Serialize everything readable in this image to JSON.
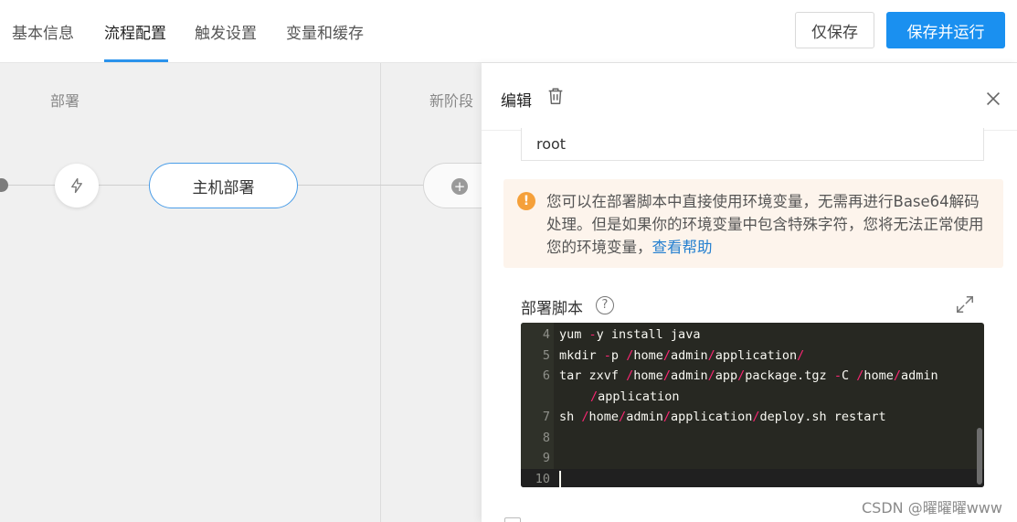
{
  "header": {
    "tabs": [
      {
        "label": "基本信息"
      },
      {
        "label": "流程配置"
      },
      {
        "label": "触发设置"
      },
      {
        "label": "变量和缓存"
      }
    ],
    "save_label": "仅保存",
    "save_run_label": "保存并运行"
  },
  "canvas": {
    "stage_1_title": "部署",
    "stage_2_title": "新阶段",
    "job_label": "主机部署"
  },
  "panel": {
    "title": "编辑",
    "field_value": "root",
    "alert": {
      "text": "您可以在部署脚本中直接使用环境变量，无需再进行Base64解码处理。但是如果你的环境变量中包含特殊字符，您将无法正常使用您的环境变量，",
      "link": "查看帮助"
    },
    "script_label": "部署脚本",
    "code": [
      {
        "ln": "4",
        "text": "yum -y install java"
      },
      {
        "ln": "5",
        "text": "mkdir -p /home/admin/application/"
      },
      {
        "ln": "6",
        "text": "tar zxvf /home/admin/app/package.tgz -C /home/admin"
      },
      {
        "ln": "",
        "text": "/application"
      },
      {
        "ln": "7",
        "text": "sh /home/admin/application/deploy.sh restart"
      },
      {
        "ln": "8",
        "text": ""
      },
      {
        "ln": "9",
        "text": ""
      },
      {
        "ln": "10",
        "text": ""
      }
    ]
  },
  "watermark": "CSDN @曜曜曜www",
  "colors": {
    "accent": "#1a90f0",
    "tab_underline": "#2a93ec",
    "warning": "#f5a03a",
    "editor_bg": "#272822",
    "operator": "#f92672"
  }
}
